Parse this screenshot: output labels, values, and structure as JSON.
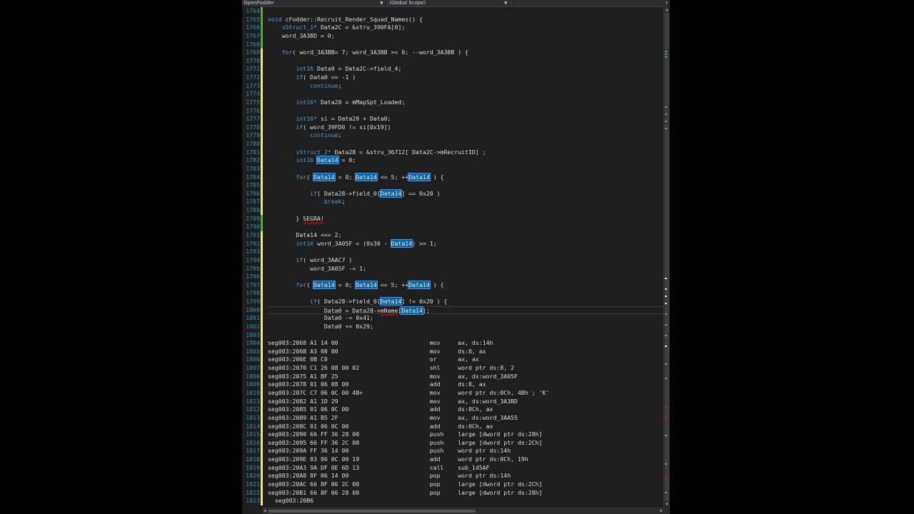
{
  "colors": {
    "background": "#1e1e1e",
    "line_number": "#2b91af",
    "keyword": "#569cd6",
    "plain": "#dcdcdc",
    "number": "#b5cea8",
    "highlight": "#0e639c",
    "change_saved": "#57a64a",
    "change_unsaved": "#efe38a",
    "error": "#e51400"
  },
  "nav": {
    "project": "OpenFodder",
    "scope": "(Global Scope)",
    "member": ""
  },
  "lines": [
    {
      "n": "1764",
      "segs": []
    },
    {
      "n": "1765",
      "segs": [
        [
          "kw",
          "void"
        ],
        [
          "p",
          " cFodder::Recruit_Render_Squad_Names() {"
        ]
      ]
    },
    {
      "n": "1766",
      "segs": [
        [
          "p",
          "    "
        ],
        [
          "kw",
          "sStruct_1*"
        ],
        [
          "p",
          " Data2C = &stru_390FA[0];"
        ]
      ]
    },
    {
      "n": "1767",
      "segs": [
        [
          "p",
          "    word_3A3BD = 0;"
        ]
      ]
    },
    {
      "n": "1768",
      "segs": []
    },
    {
      "n": "1769",
      "segs": [
        [
          "p",
          "    "
        ],
        [
          "kw",
          "for"
        ],
        [
          "p",
          "( word_3A3BB= 7; word_3A3BB >= 0; --word_3A3BB ) {"
        ]
      ]
    },
    {
      "n": "1770",
      "segs": []
    },
    {
      "n": "1771",
      "segs": [
        [
          "p",
          "        "
        ],
        [
          "kw",
          "int16"
        ],
        [
          "p",
          " Data0 = Data2C->field_4;"
        ]
      ]
    },
    {
      "n": "1772",
      "segs": [
        [
          "p",
          "        "
        ],
        [
          "kw",
          "if"
        ],
        [
          "p",
          "( Data0 == -1 )"
        ]
      ]
    },
    {
      "n": "1773",
      "segs": [
        [
          "p",
          "            "
        ],
        [
          "kw",
          "continue"
        ],
        [
          "p",
          ";"
        ]
      ]
    },
    {
      "n": "1774",
      "segs": []
    },
    {
      "n": "1775",
      "segs": [
        [
          "p",
          "        "
        ],
        [
          "kw",
          "int16*"
        ],
        [
          "p",
          " Data20 = mMapSpt_Loaded;"
        ]
      ]
    },
    {
      "n": "1776",
      "segs": []
    },
    {
      "n": "1777",
      "segs": [
        [
          "p",
          "        "
        ],
        [
          "kw",
          "int16*"
        ],
        [
          "p",
          " si = Data20 + Data0;"
        ]
      ]
    },
    {
      "n": "1778",
      "segs": [
        [
          "p",
          "        "
        ],
        [
          "kw",
          "if"
        ],
        [
          "p",
          "( word_39FD0 != si[0x19])"
        ]
      ]
    },
    {
      "n": "1779",
      "segs": [
        [
          "p",
          "            "
        ],
        [
          "kw",
          "continue"
        ],
        [
          "p",
          ";"
        ]
      ]
    },
    {
      "n": "1780",
      "segs": []
    },
    {
      "n": "1781",
      "segs": [
        [
          "p",
          "        "
        ],
        [
          "kw",
          "sStruct_2*"
        ],
        [
          "p",
          " Data28 = &stru_36712[ Data2C->mRecruitID] ;"
        ]
      ]
    },
    {
      "n": "1782",
      "segs": [
        [
          "p",
          "        "
        ],
        [
          "kw",
          "int16"
        ],
        [
          "p",
          " "
        ],
        [
          "hl",
          "Data14"
        ],
        [
          "p",
          " = 0;"
        ]
      ]
    },
    {
      "n": "1783",
      "segs": []
    },
    {
      "n": "1784",
      "segs": [
        [
          "p",
          "        "
        ],
        [
          "kw",
          "for"
        ],
        [
          "p",
          "( "
        ],
        [
          "hl",
          "Data14"
        ],
        [
          "p",
          " = 0; "
        ],
        [
          "hl",
          "Data14"
        ],
        [
          "p",
          " <= 5; ++"
        ],
        [
          "hl",
          "Data14"
        ],
        [
          "p",
          " ) {"
        ]
      ]
    },
    {
      "n": "1785",
      "segs": []
    },
    {
      "n": "1786",
      "segs": [
        [
          "p",
          "            "
        ],
        [
          "kw",
          "if"
        ],
        [
          "p",
          "( Data28->field_0["
        ],
        [
          "hl",
          "Data14"
        ],
        [
          "p",
          "] == 0x20 )"
        ]
      ]
    },
    {
      "n": "1787",
      "segs": [
        [
          "p",
          "                "
        ],
        [
          "kw",
          "break"
        ],
        [
          "p",
          ";"
        ]
      ]
    },
    {
      "n": "1788",
      "segs": []
    },
    {
      "n": "1789",
      "segs": [
        [
          "p",
          "        } "
        ],
        [
          "err",
          "SEGRA!"
        ]
      ]
    },
    {
      "n": "1790",
      "segs": []
    },
    {
      "n": "1791",
      "segs": [
        [
          "p",
          "        Data14 <<= 2;"
        ]
      ]
    },
    {
      "n": "1792",
      "segs": [
        [
          "p",
          "        "
        ],
        [
          "kw",
          "int16"
        ],
        [
          "p",
          " word_3A05F = (0x30 - "
        ],
        [
          "hl",
          "Data14"
        ],
        [
          "p",
          ") >> 1;"
        ]
      ]
    },
    {
      "n": "1793",
      "segs": []
    },
    {
      "n": "1794",
      "segs": [
        [
          "p",
          "        "
        ],
        [
          "kw",
          "if"
        ],
        [
          "p",
          "( word_3AAC7 )"
        ]
      ]
    },
    {
      "n": "1795",
      "segs": [
        [
          "p",
          "            word_3A05F -= 1;"
        ]
      ]
    },
    {
      "n": "1796",
      "segs": []
    },
    {
      "n": "1797",
      "segs": [
        [
          "p",
          "        "
        ],
        [
          "kw",
          "for"
        ],
        [
          "p",
          "( "
        ],
        [
          "hl",
          "Data14"
        ],
        [
          "p",
          " = 0; "
        ],
        [
          "hl",
          "Data14"
        ],
        [
          "p",
          " <= 5; ++"
        ],
        [
          "hl",
          "Data14"
        ],
        [
          "p",
          " ) {"
        ]
      ]
    },
    {
      "n": "1798",
      "segs": []
    },
    {
      "n": "1799",
      "segs": [
        [
          "p",
          "            "
        ],
        [
          "kw",
          "if"
        ],
        [
          "p",
          "( Data28->field_0["
        ],
        [
          "hl",
          "Data14"
        ],
        [
          "p",
          "] != 0x20 ) {"
        ]
      ]
    },
    {
      "n": "1800",
      "segs": [
        [
          "p",
          "                Data0 = Data28->"
        ],
        [
          "err",
          "mName"
        ],
        [
          "p",
          "["
        ],
        [
          "hl",
          "Data14"
        ],
        [
          "p",
          "];"
        ]
      ]
    },
    {
      "n": "1801",
      "segs": [
        [
          "p",
          "                Data0 -= 0x41;"
        ]
      ]
    },
    {
      "n": "1802",
      "segs": [
        [
          "p",
          "                Data0 += 0x29;"
        ]
      ]
    },
    {
      "n": "1803",
      "segs": []
    },
    {
      "n": "1804",
      "segs": [
        [
          "p",
          "seg003:2068 A1 14 00                          mov     ax, ds:14h"
        ]
      ]
    },
    {
      "n": "1805",
      "segs": [
        [
          "p",
          "seg003:206B A3 08 00                          mov     ds:8, ax"
        ]
      ]
    },
    {
      "n": "1806",
      "segs": [
        [
          "p",
          "seg003:206E 0B C0                             or      ax, ax"
        ]
      ]
    },
    {
      "n": "1807",
      "segs": [
        [
          "p",
          "seg003:2070 C1 26 08 00 02                    shl     word ptr ds:8, 2"
        ]
      ]
    },
    {
      "n": "1808",
      "segs": [
        [
          "p",
          "seg003:2075 A1 BF 25                          mov     ax, ds:word_3A05F"
        ]
      ]
    },
    {
      "n": "1809",
      "segs": [
        [
          "p",
          "seg003:2078 01 06 08 00                       add     ds:8, ax"
        ]
      ]
    },
    {
      "n": "1810",
      "segs": [
        [
          "p",
          "seg003:207C C7 06 0C 00 4B+                   mov     word ptr ds:0Ch, 4Bh ; 'K'"
        ]
      ]
    },
    {
      "n": "1811",
      "segs": [
        [
          "p",
          "seg003:2082 A1 1D 29                          mov     ax, ds:word_3A3BD"
        ]
      ]
    },
    {
      "n": "1812",
      "segs": [
        [
          "p",
          "seg003:2085 01 06 0C 00                       add     ds:0Ch, ax"
        ]
      ]
    },
    {
      "n": "1813",
      "segs": [
        [
          "p",
          "seg003:2089 A1 B5 2F                          mov     ax, ds:word_3AA55"
        ]
      ]
    },
    {
      "n": "1814",
      "segs": [
        [
          "p",
          "seg003:208C 01 06 0C 00                       add     ds:0Ch, ax"
        ]
      ]
    },
    {
      "n": "1815",
      "segs": [
        [
          "p",
          "seg003:2090 66 FF 36 28 00                    push    large [dword ptr ds:28h]"
        ]
      ]
    },
    {
      "n": "1816",
      "segs": [
        [
          "p",
          "seg003:2095 66 FF 36 2C 00                    push    large [dword ptr ds:2Ch]"
        ]
      ]
    },
    {
      "n": "1817",
      "segs": [
        [
          "p",
          "seg003:209A FF 36 14 00                       push    word ptr ds:14h"
        ]
      ]
    },
    {
      "n": "1818",
      "segs": [
        [
          "p",
          "seg003:209E 83 06 0C 00 19                    add     word ptr ds:0Ch, 19h"
        ]
      ]
    },
    {
      "n": "1819",
      "segs": [
        [
          "p",
          "seg003:20A3 9A DF 0E 6D 13                    call    sub_145AF"
        ]
      ]
    },
    {
      "n": "1820",
      "segs": [
        [
          "p",
          "seg003:20A8 8F 06 14 00                       pop     word ptr ds:14h"
        ]
      ]
    },
    {
      "n": "1821",
      "segs": [
        [
          "p",
          "seg003:20AC 66 8F 06 2C 00                    pop     large [dword ptr ds:2Ch]"
        ]
      ]
    },
    {
      "n": "1822",
      "segs": [
        [
          "p",
          "seg003:20B1 66 8F 06 28 00                    pop     large [dword ptr ds:28h]"
        ]
      ]
    },
    {
      "n": "1823",
      "segs": [
        [
          "p",
          "  seg003:20B6"
        ]
      ]
    }
  ],
  "change_marks": [
    {
      "from": 1764,
      "to": 1768,
      "state": "saved"
    },
    {
      "from": 1769,
      "to": 1788,
      "state": "unsaved"
    },
    {
      "from": 1789,
      "to": 1790,
      "state": "saved"
    },
    {
      "from": 1791,
      "to": 1823,
      "state": "unsaved"
    }
  ],
  "current_line": "1800"
}
